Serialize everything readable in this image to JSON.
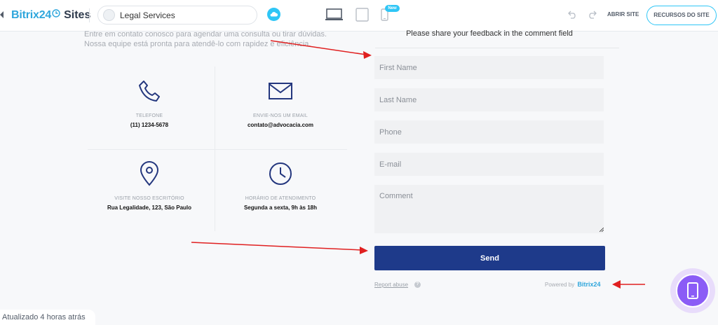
{
  "header": {
    "logo_brand": "Bitrix24",
    "logo_product": "Sites",
    "site_name": "Legal Services",
    "new_badge": "New",
    "open_site_label": "ABRIR SITE",
    "resources_label": "RECURSOS DO SITE"
  },
  "contact": {
    "intro": "Entre em contato conosco para agendar uma consulta ou tirar dúvidas. Nossa equipe está pronta para atendê-lo com rapidez e eficiência.",
    "items": [
      {
        "label": "TELEFONE",
        "value": "(11) 1234-5678",
        "icon": "phone-icon"
      },
      {
        "label": "ENVIE-NOS UM EMAIL",
        "value": "contato@advocacia.com",
        "icon": "envelope-icon"
      },
      {
        "label": "VISITE NOSSO ESCRITÓRIO",
        "value": "Rua Legalidade, 123, São Paulo",
        "icon": "location-pin-icon"
      },
      {
        "label": "HORÁRIO DE ATENDIMENTO",
        "value": "Segunda a sexta, 9h às 18h",
        "icon": "clock-icon"
      }
    ]
  },
  "form": {
    "title": "Please share your feedback in the comment field",
    "first_name_placeholder": "First Name",
    "last_name_placeholder": "Last Name",
    "phone_placeholder": "Phone",
    "email_placeholder": "E-mail",
    "comment_placeholder": "Comment",
    "send_label": "Send",
    "report_abuse_label": "Report abuse",
    "help_glyph": "?",
    "powered_by_label": "Powered by",
    "powered_by_brand": "Bitrix24"
  },
  "footer": {
    "updated_label": "Atualizado 4 horas atrás"
  },
  "colors": {
    "accent": "#2fc6f6",
    "brand": "#2fa6dc",
    "button": "#1e3a8a",
    "annotation_arrow": "#e02020",
    "mobile_fab": "#8b5cf6"
  }
}
